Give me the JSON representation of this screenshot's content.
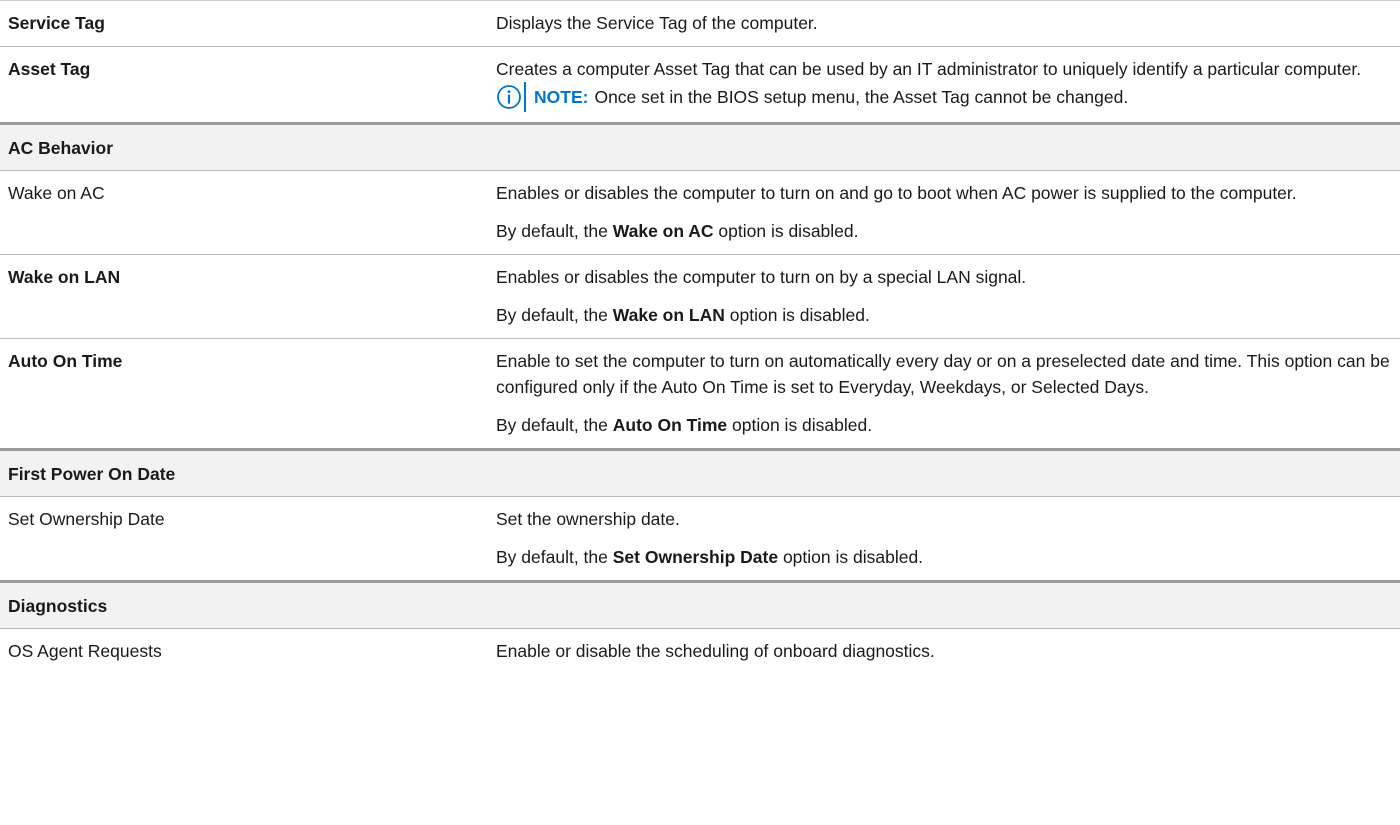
{
  "rows": {
    "service_tag": {
      "label": "Service Tag",
      "desc": "Displays the Service Tag of the computer."
    },
    "asset_tag": {
      "label": "Asset Tag",
      "desc": "Creates a computer Asset Tag that can be used by an IT administrator to uniquely identify a particular computer.",
      "note_label": "NOTE:",
      "note_text": "Once set in the BIOS setup menu, the Asset Tag cannot be changed."
    },
    "ac_behavior": {
      "label": "AC Behavior"
    },
    "wake_on_ac": {
      "label": "Wake on AC",
      "desc": "Enables or disables the computer to turn on and go to boot when AC power is supplied to the computer.",
      "default_pre": "By default, the ",
      "default_bold": "Wake on AC",
      "default_post": " option is disabled."
    },
    "wake_on_lan": {
      "label": "Wake on LAN",
      "desc": "Enables or disables the computer to turn on by a special LAN signal.",
      "default_pre": "By default, the ",
      "default_bold": "Wake on LAN",
      "default_post": " option is disabled."
    },
    "auto_on_time": {
      "label": "Auto On Time",
      "desc": "Enable to set the computer to turn on automatically every day or on a preselected date and time. This option can be configured only if the Auto On Time is set to Everyday, Weekdays, or Selected Days.",
      "default_pre": "By default, the ",
      "default_bold": "Auto On Time",
      "default_post": " option is disabled."
    },
    "first_power_on_date": {
      "label": "First Power On Date"
    },
    "set_ownership_date": {
      "label": "Set Ownership Date",
      "desc": "Set the ownership date.",
      "default_pre": "By default, the ",
      "default_bold": "Set Ownership Date",
      "default_post": " option is disabled."
    },
    "diagnostics": {
      "label": "Diagnostics"
    },
    "os_agent_requests": {
      "label": "OS Agent Requests",
      "desc": "Enable or disable the scheduling of onboard diagnostics."
    }
  },
  "colors": {
    "note_accent": "#0076ce",
    "rule": "#b9b9b9",
    "section_bg": "#f2f2f2"
  },
  "icons": {
    "note": "info-circle-icon"
  }
}
